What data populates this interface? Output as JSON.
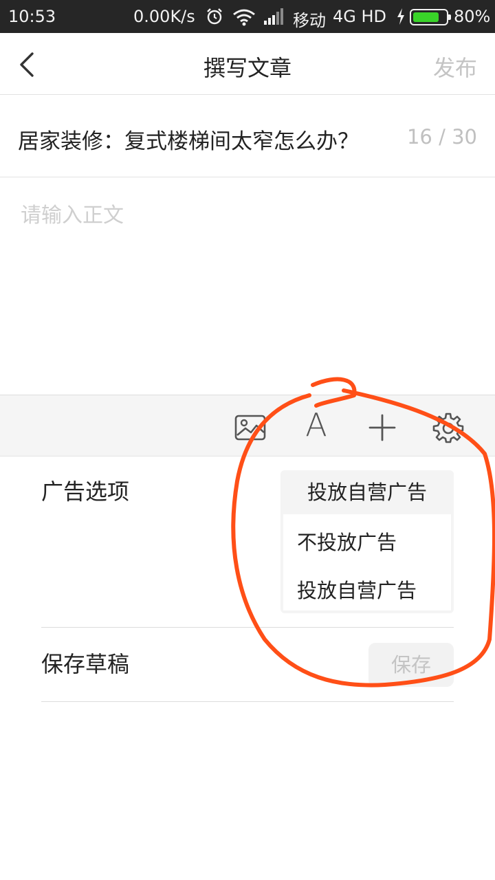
{
  "status_bar": {
    "time": "10:53",
    "speed": "0.00K/s",
    "carrier": "移动",
    "network": "4G HD",
    "battery_pct": "80%",
    "battery_level": 0.8,
    "battery_color": "#39d429"
  },
  "nav": {
    "title": "撰写文章",
    "publish_label": "发布"
  },
  "article": {
    "title": "居家装修：复式楼梯间太窄怎么办？",
    "counter": "16 / 30",
    "body_placeholder": "请输入正文"
  },
  "toolbar": {
    "icons": [
      "image-icon",
      "font-icon",
      "plus-icon",
      "gear-icon"
    ],
    "font_glyph": "A"
  },
  "ad_options": {
    "label": "广告选项",
    "selected": "投放自营广告",
    "options": [
      "不投放广告",
      "投放自营广告"
    ]
  },
  "save_draft": {
    "label": "保存草稿",
    "button_label": "保存"
  },
  "colors": {
    "annotation": "#ff4f17",
    "muted_text": "#c4c4c4"
  }
}
